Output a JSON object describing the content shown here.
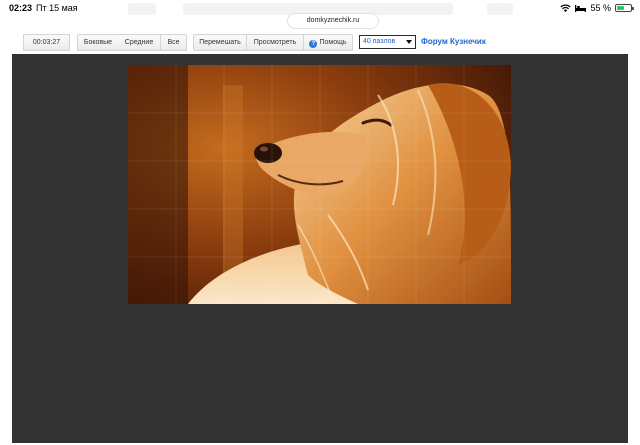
{
  "status_bar": {
    "time": "02:23",
    "date": "Пт 15 мая",
    "battery_percent": "55 %",
    "battery_level": 0.55
  },
  "browser": {
    "url": "domkyznechik.ru"
  },
  "toolbar": {
    "timer": "00:03:27",
    "edges_label": "Боковые",
    "middle_label": "Средние",
    "all_label": "Все",
    "shuffle_label": "Перемешать",
    "preview_label": "Просмотреть",
    "help_label": "Помощь",
    "pieces_select": "40 пазлов",
    "forum_link": "Форум Кузнечик"
  },
  "colors": {
    "board": "#333333",
    "link": "#2266cc",
    "help_icon": "#2f7ad9"
  },
  "puzzle": {
    "image": "golden-retriever-dog-photo"
  }
}
